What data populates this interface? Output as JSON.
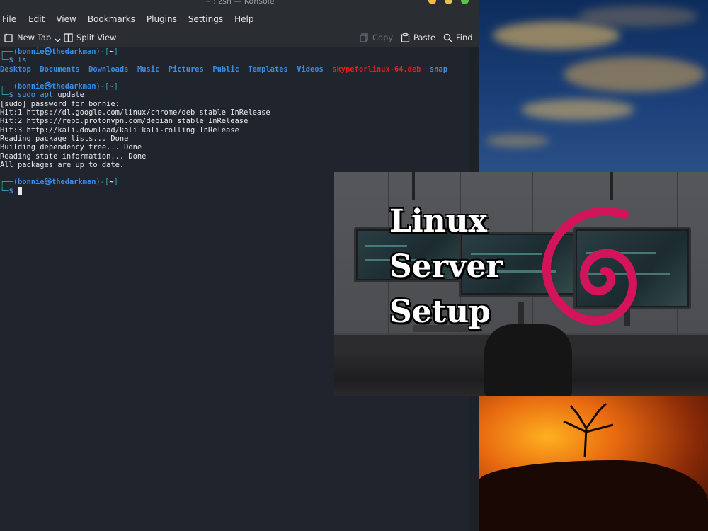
{
  "window": {
    "title": "~ : zsh — Konsole",
    "control_colors": [
      "#f5b942",
      "#e0c24a",
      "#58c24a"
    ]
  },
  "menu": [
    "File",
    "Edit",
    "View",
    "Bookmarks",
    "Plugins",
    "Settings",
    "Help"
  ],
  "toolbar": {
    "new_tab": "New Tab",
    "split_view": "Split View",
    "copy": "Copy",
    "paste": "Paste",
    "find": "Find"
  },
  "terminal": {
    "prompt_user": "bonnie",
    "prompt_host": "thedarkman",
    "prompt_dir": "~",
    "cmd1": "ls",
    "ls_dirs": [
      "Desktop",
      "Documents",
      "Downloads",
      "Music",
      "Pictures",
      "Public",
      "Templates",
      "Videos"
    ],
    "ls_file": "skypeforlinux-64.deb",
    "ls_last": "snap",
    "cmd2_sudo": "sudo",
    "cmd2_apt": "apt",
    "cmd2_arg": "update",
    "output": [
      "[sudo] password for bonnie:",
      "Hit:1 https://dl.google.com/linux/chrome/deb stable InRelease",
      "Hit:2 https://repo.protonvpn.com/debian stable InRelease",
      "Hit:3 http://kali.download/kali kali-rolling InRelease",
      "Reading package lists... Done",
      "Building dependency tree... Done",
      "Reading state information... Done",
      "All packages are up to date."
    ]
  },
  "overlay": {
    "line1": "Linux",
    "line2": "Server",
    "line3": "Setup",
    "accent": "#d4145a"
  }
}
